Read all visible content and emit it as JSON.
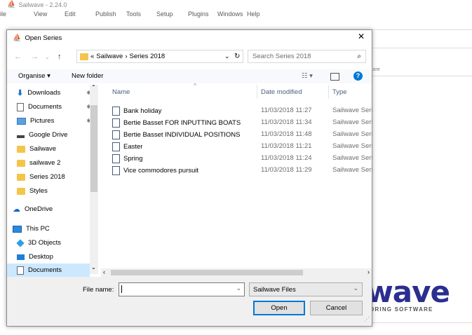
{
  "app": {
    "title": "Sailwave - 2.24.0",
    "menu": [
      "ile",
      "View",
      "Edit",
      "Publish",
      "Tools",
      "Setup",
      "Plugins",
      "Windows",
      "Help"
    ],
    "side_text": "core",
    "logo_word": "wave",
    "logo_sub": "ORING SOFTWARE"
  },
  "dialog": {
    "title": "Open Series",
    "address": {
      "crumbs": [
        "«",
        "Sailwave",
        "›",
        "Series 2018"
      ]
    },
    "search_placeholder": "Search Series 2018",
    "toolbar": {
      "organise": "Organise ▾",
      "new_folder": "New folder"
    },
    "nav": [
      {
        "label": "Downloads",
        "icon": "download-icon",
        "pinned": true
      },
      {
        "label": "Documents",
        "icon": "documents-icon",
        "pinned": true
      },
      {
        "label": "Pictures",
        "icon": "pictures-icon",
        "pinned": true
      },
      {
        "label": "Google Drive",
        "icon": "drive-icon",
        "pinned": true
      },
      {
        "label": "Sailwave",
        "icon": "folder-icon",
        "pinned": false
      },
      {
        "label": "sailwave 2",
        "icon": "folder-icon",
        "pinned": false
      },
      {
        "label": "Series 2018",
        "icon": "folder-icon",
        "pinned": false
      },
      {
        "label": "Styles",
        "icon": "folder-icon",
        "pinned": false
      },
      {
        "label": "OneDrive",
        "icon": "cloud-icon",
        "pinned": false
      },
      {
        "label": "This PC",
        "icon": "pc-icon",
        "pinned": false
      },
      {
        "label": "3D Objects",
        "icon": "3d-objects-icon",
        "pinned": false
      },
      {
        "label": "Desktop",
        "icon": "desktop-icon",
        "pinned": false
      },
      {
        "label": "Documents",
        "icon": "documents-icon",
        "pinned": false,
        "selected": true
      }
    ],
    "columns": {
      "name": "Name",
      "date": "Date modified",
      "type": "Type"
    },
    "files": [
      {
        "name": "Bank holiday",
        "date": "11/03/2018 11:27",
        "type": "Sailwave Seri"
      },
      {
        "name": "Bertie Basset FOR INPUTTING BOATS",
        "date": "11/03/2018 11:34",
        "type": "Sailwave Seri"
      },
      {
        "name": "Bertie Basset INDIVIDUAL POSITIONS",
        "date": "11/03/2018 11:48",
        "type": "Sailwave Seri"
      },
      {
        "name": "Easter",
        "date": "11/03/2018 11:21",
        "type": "Sailwave Seri"
      },
      {
        "name": "Spring",
        "date": "11/03/2018 11:24",
        "type": "Sailwave Seri"
      },
      {
        "name": "Vice commodores pursuit",
        "date": "11/03/2018 11:29",
        "type": "Sailwave Seri"
      }
    ],
    "file_name_label": "File name:",
    "file_name_value": "",
    "filter": "Sailwave Files",
    "open_label": "Open",
    "cancel_label": "Cancel"
  },
  "colors": {
    "accent": "#0078d7",
    "selected": "#cce8ff",
    "logo": "#2a2f8f",
    "folder": "#f4c54a"
  }
}
